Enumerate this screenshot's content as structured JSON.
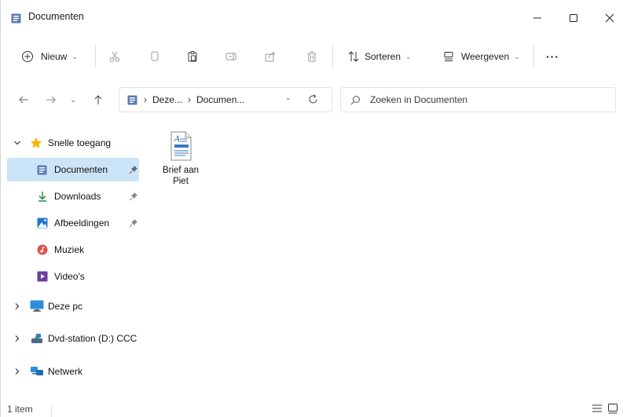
{
  "window": {
    "title": "Documenten"
  },
  "toolbar": {
    "new_label": "Nieuw",
    "sort_label": "Sorteren",
    "view_label": "Weergeven",
    "more_label": "···"
  },
  "address": {
    "segments": [
      "Deze...",
      "Documen..."
    ],
    "search_placeholder": "Zoeken in Documenten"
  },
  "nav": {
    "quick_access": "Snelle toegang",
    "items": [
      {
        "label": "Documenten",
        "icon": "documents-icon",
        "pinned": true,
        "selected": true
      },
      {
        "label": "Downloads",
        "icon": "download-icon",
        "pinned": true
      },
      {
        "label": "Afbeeldingen",
        "icon": "pictures-icon",
        "pinned": true
      },
      {
        "label": "Muziek",
        "icon": "music-icon"
      },
      {
        "label": "Video's",
        "icon": "video-icon"
      }
    ],
    "this_pc": "Deze pc",
    "dvd": "Dvd-station (D:) CCC",
    "network": "Netwerk"
  },
  "content": {
    "files": [
      {
        "name_line1": "Brief aan",
        "name_line2": "Piet",
        "icon": "wordpad-document-icon"
      }
    ]
  },
  "status": {
    "count": "1 item"
  },
  "colors": {
    "selected_bg": "#cce4f7",
    "accent": "#0067c0"
  }
}
